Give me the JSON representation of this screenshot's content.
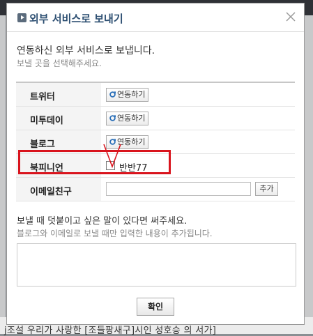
{
  "background": {
    "bottom_text": "j조설 우리가 사랑한 [조들팡새구]시인 성호승 의 서가]"
  },
  "dialog": {
    "title": "외부 서비스로 보내기",
    "intro_main": "연동하신 외부 서비스로 보냅니다.",
    "intro_sub": "보낼 곳을 선택해주세요.",
    "services": [
      {
        "label": "트위터",
        "button": "연동하기"
      },
      {
        "label": "미투데이",
        "button": "연동하기"
      },
      {
        "label": "블로그",
        "button": "연동하기"
      },
      {
        "label": "북피니언",
        "checkbox_label": "반반77",
        "checked": false
      },
      {
        "label": "이메일친구",
        "add_button": "추가",
        "email_value": ""
      }
    ],
    "memo_main": "보낼 때 덧붙이고 싶은 말이 있다면 써주세요.",
    "memo_sub": "블로그와 이메일로 보낼 때만 입력한 내용이 추가됩니다.",
    "memo_value": "",
    "confirm_label": "확인"
  },
  "colors": {
    "title": "#2d4f72",
    "highlight": "#d9141d"
  },
  "icons": {
    "close": "close-icon",
    "title": "arrow-right-icon",
    "connect": "link-icon"
  }
}
